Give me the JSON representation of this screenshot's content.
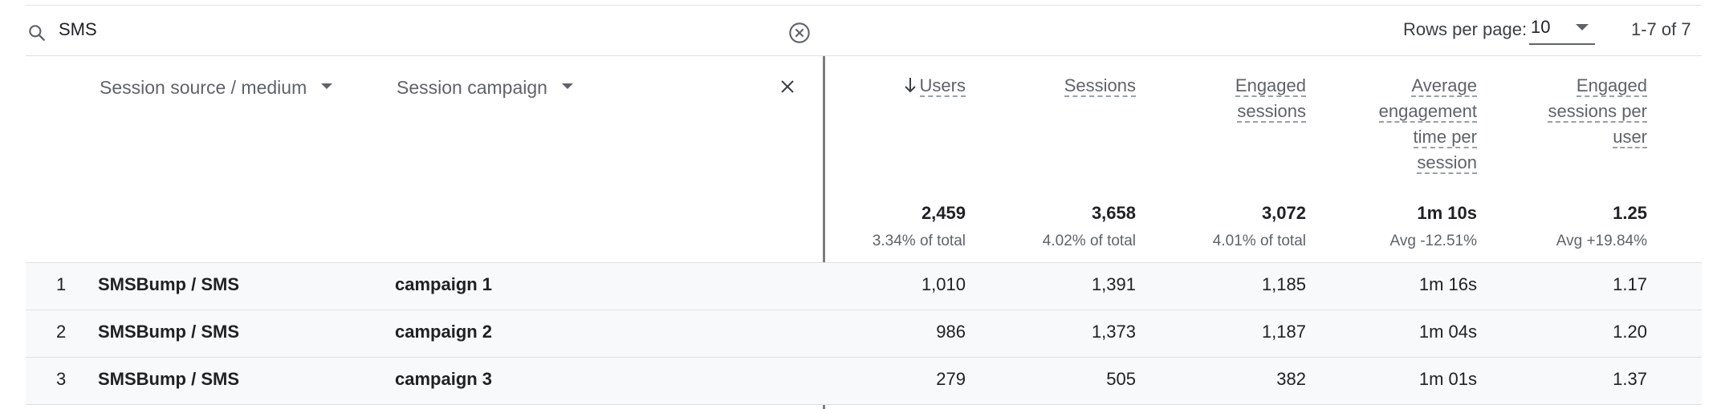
{
  "search": {
    "value": "SMS"
  },
  "pagination": {
    "rows_per_page_label": "Rows per page:",
    "rows_per_page_value": "10",
    "range": "1-7 of 7"
  },
  "dimensions": {
    "primary_label": "Session source / medium",
    "secondary_label": "Session campaign"
  },
  "metrics": {
    "users": {
      "label": "Users",
      "total": "2,459",
      "sub": "3.34% of total"
    },
    "sessions": {
      "label": "Sessions",
      "total": "3,658",
      "sub": "4.02% of total"
    },
    "engaged_sessions": {
      "label_1": "Engaged",
      "label_2": "sessions",
      "total": "3,072",
      "sub": "4.01% of total"
    },
    "avg_engagement": {
      "label_1": "Average",
      "label_2": "engagement",
      "label_3": "time per",
      "label_4": "session",
      "total": "1m 10s",
      "sub": "Avg -12.51%"
    },
    "engaged_per_user": {
      "label_1": "Engaged",
      "label_2": "sessions per",
      "label_3": "user",
      "total": "1.25",
      "sub": "Avg +19.84%"
    }
  },
  "rows": [
    {
      "index": "1",
      "source": "SMSBump / SMS",
      "campaign": "campaign 1",
      "users": "1,010",
      "sessions": "1,391",
      "engaged": "1,185",
      "avg_time": "1m 16s",
      "per_user": "1.17"
    },
    {
      "index": "2",
      "source": "SMSBump / SMS",
      "campaign": "campaign 2",
      "users": "986",
      "sessions": "1,373",
      "engaged": "1,187",
      "avg_time": "1m 04s",
      "per_user": "1.20"
    },
    {
      "index": "3",
      "source": "SMSBump / SMS",
      "campaign": "campaign 3",
      "users": "279",
      "sessions": "505",
      "engaged": "382",
      "avg_time": "1m 01s",
      "per_user": "1.37"
    }
  ],
  "colors": {
    "row_bg": "#f8f9fa",
    "divider": "#7d7d7d",
    "text": "#202124",
    "muted": "#5f6368"
  },
  "icons": {
    "search": "search-icon",
    "clear": "clear-circle-icon",
    "close": "close-icon",
    "sort": "arrow-down-icon",
    "caret": "caret-down-icon"
  }
}
